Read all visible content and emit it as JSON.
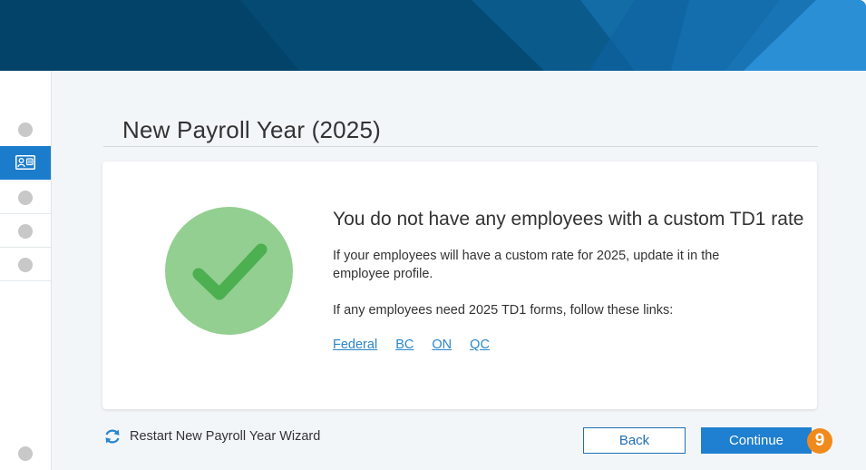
{
  "page": {
    "title": "New Payroll Year (2025)"
  },
  "steps": [
    {
      "icon": "step-dot",
      "state": "inactive"
    },
    {
      "icon": "employee-card-icon",
      "state": "active"
    },
    {
      "icon": "step-dot",
      "state": "inactive"
    },
    {
      "icon": "step-dot",
      "state": "inactive"
    },
    {
      "icon": "step-dot",
      "state": "inactive"
    }
  ],
  "card": {
    "icon": "checkmark-icon",
    "heading": "You do not have any employees with a custom TD1 rate",
    "paragraph1": "If your employees will have a custom rate for 2025, update it in the employee profile.",
    "paragraph2": "If any employees need 2025 TD1 forms, follow these links:",
    "links": [
      "Federal",
      "BC",
      "ON",
      "QC"
    ]
  },
  "footer": {
    "restart_label": "Restart New Payroll Year Wizard",
    "back_label": "Back",
    "continue_label": "Continue",
    "badge": "9"
  },
  "colors": {
    "banner": "#03436a",
    "accent": "#1f7fd0",
    "check_circle": "#93cf91",
    "check_mark": "#4caf50",
    "badge": "#f08a1c",
    "link": "#2a86cc"
  }
}
